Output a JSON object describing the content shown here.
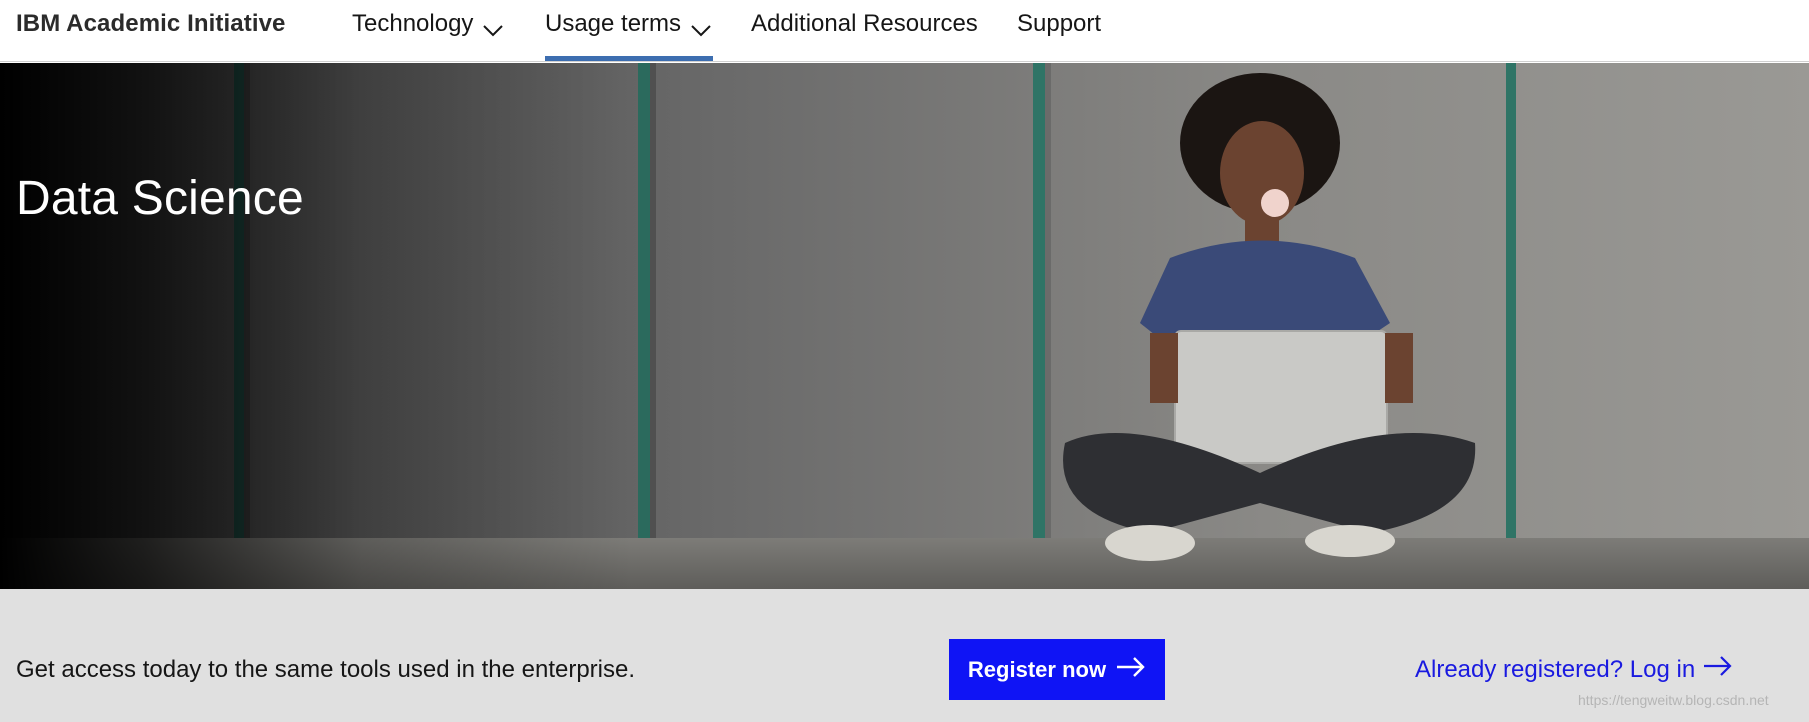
{
  "header": {
    "brand": "IBM Academic Initiative",
    "nav": {
      "technology": "Technology",
      "usage_terms": "Usage terms",
      "additional_resources": "Additional Resources",
      "support": "Support"
    },
    "active_item": "Usage terms"
  },
  "hero": {
    "title": "Data Science",
    "image_description_icon": "woman-laptop-photo"
  },
  "cta": {
    "text": "Get access today to the same tools used in the enterprise.",
    "register_label": "Register now",
    "login_label": "Already registered? Log in"
  },
  "watermark": "https://tengweitw.blog.csdn.net",
  "colors": {
    "accent_underline": "#3d6eb0",
    "primary_button": "#0f14f5",
    "link": "#1a1ae0",
    "band_bg": "#e0e0e0"
  }
}
